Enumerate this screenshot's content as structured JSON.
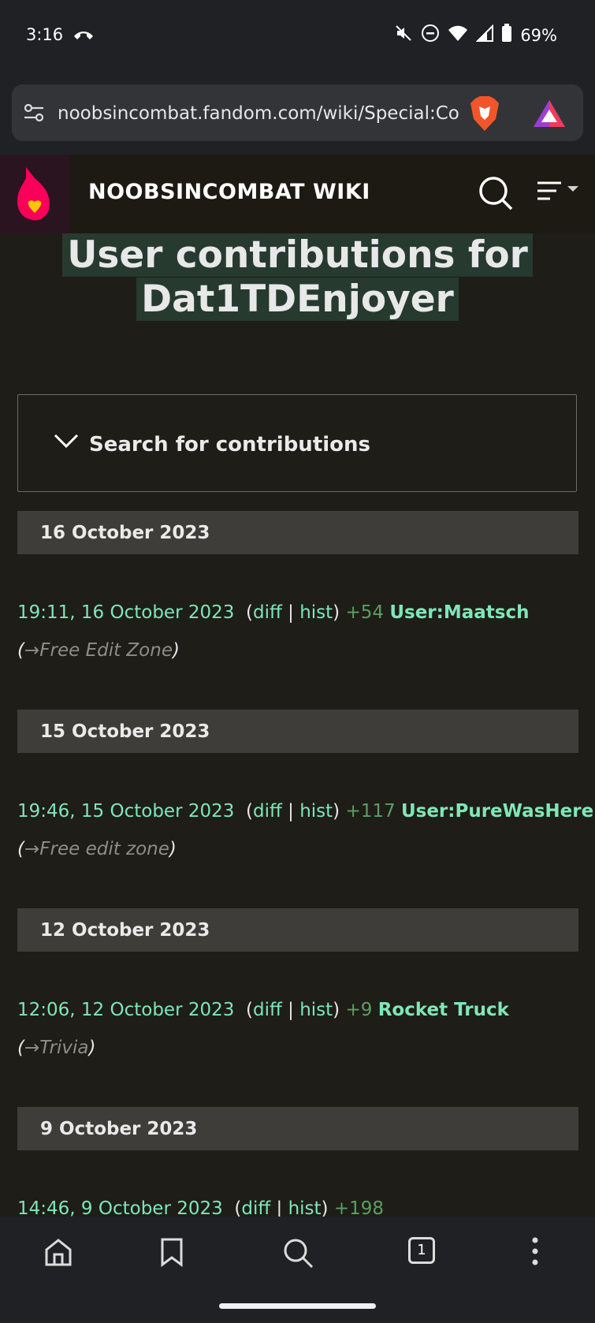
{
  "status": {
    "time": "3:16",
    "battery": "69%",
    "icons": [
      "phone-call-icon",
      "mute-icon",
      "do-not-disturb-icon",
      "wifi-icon",
      "signal-icon",
      "battery-icon"
    ]
  },
  "browser": {
    "url": "noobsincombat.fandom.com/wiki/Special:Co",
    "tab_count": "1"
  },
  "wiki": {
    "name": "NOOBSINCOMBAT WIKI"
  },
  "page": {
    "title_line1": "User contributions for",
    "title_line2": "Dat1TDEnjoyer",
    "search_label": "Search for contributions"
  },
  "groups": [
    {
      "date": "16 October 2023",
      "entries": [
        {
          "timestamp": "19:11, 16 October 2023",
          "diff": "diff",
          "hist": "hist",
          "size": "+54",
          "page": "User:Maatsch",
          "comment": "Free Edit Zone"
        }
      ]
    },
    {
      "date": "15 October 2023",
      "entries": [
        {
          "timestamp": "19:46, 15 October 2023",
          "diff": "diff",
          "hist": "hist",
          "size": "+117",
          "page": "User:PureWasHere",
          "comment": "Free edit zone"
        }
      ]
    },
    {
      "date": "12 October 2023",
      "entries": [
        {
          "timestamp": "12:06, 12 October 2023",
          "diff": "diff",
          "hist": "hist",
          "size": "+9",
          "page": "Rocket Truck",
          "comment": "Trivia"
        }
      ]
    },
    {
      "date": "9 October 2023",
      "entries": [
        {
          "timestamp": "14:46, 9 October 2023",
          "diff": "diff",
          "hist": "hist",
          "size": "+198"
        }
      ]
    }
  ],
  "colors": {
    "link": "#7ee7b8",
    "size_positive": "#5c9e63",
    "background": "#1f1d17"
  }
}
